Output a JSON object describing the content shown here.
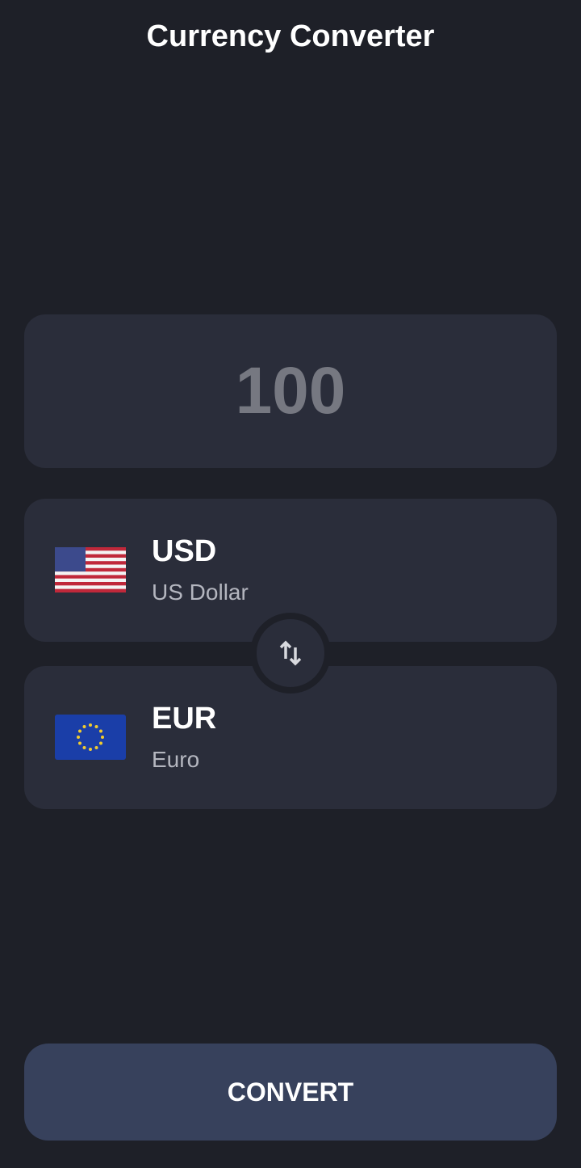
{
  "header": {
    "title": "Currency Converter"
  },
  "amount": {
    "value": "100"
  },
  "from": {
    "code": "USD",
    "name": "US Dollar",
    "flag_icon": "us-flag-icon"
  },
  "to": {
    "code": "EUR",
    "name": "Euro",
    "flag_icon": "eu-flag-icon"
  },
  "swap": {
    "icon": "swap-vertical-icon"
  },
  "convert": {
    "label": "CONVERT"
  },
  "colors": {
    "background": "#1e2028",
    "card": "#2a2d3a",
    "button": "#37415c"
  }
}
